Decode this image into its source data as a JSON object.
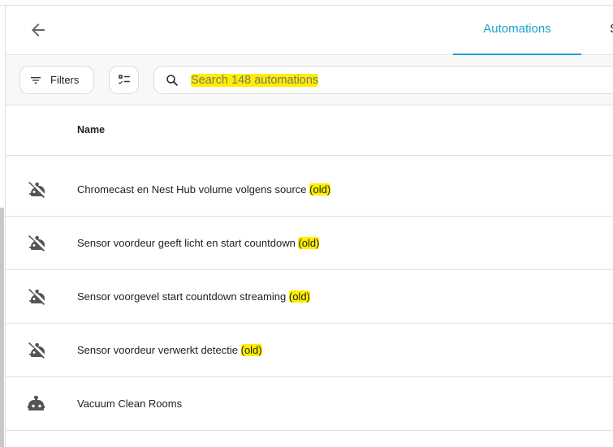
{
  "header": {
    "tabs": [
      {
        "label": "Automations",
        "active": true
      },
      {
        "label": "S",
        "active": false
      }
    ]
  },
  "toolbar": {
    "filters_label": "Filters",
    "search_placeholder": "Search 148 automations"
  },
  "table": {
    "columns": [
      "Name"
    ],
    "rows": [
      {
        "name": "Chromecast en Nest Hub volume volgens source",
        "suffix": "(old)",
        "icon": "robot-off-icon"
      },
      {
        "name": "Sensor voordeur geeft licht en start countdown",
        "suffix": "(old)",
        "icon": "robot-off-icon"
      },
      {
        "name": "Sensor voorgevel start countdown streaming",
        "suffix": "(old)",
        "icon": "robot-off-icon"
      },
      {
        "name": "Sensor voordeur verwerkt detectie",
        "suffix": "(old)",
        "icon": "robot-off-icon"
      },
      {
        "name": "Vacuum Clean Rooms",
        "suffix": "",
        "icon": "robot-icon"
      }
    ]
  },
  "colors": {
    "accent": "#1a9fce",
    "highlight": "#ffee00"
  }
}
